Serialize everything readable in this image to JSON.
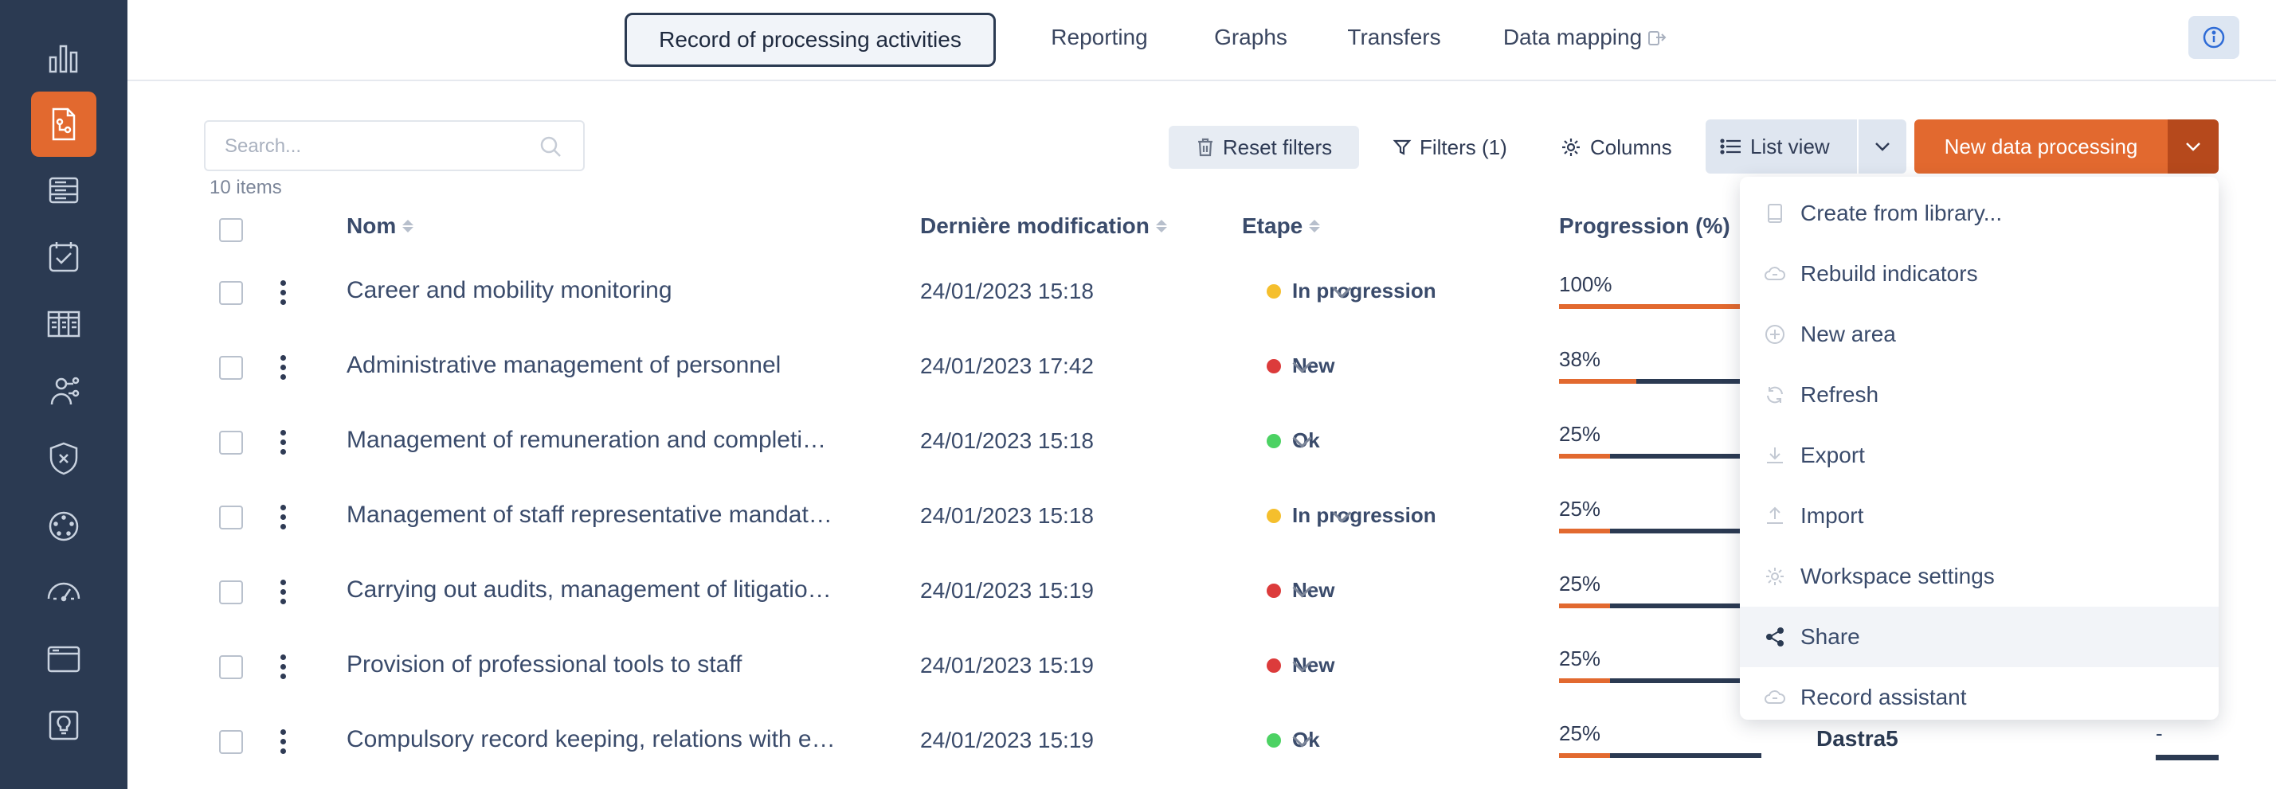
{
  "nav": {
    "tabs": [
      {
        "label": "Record of processing activities"
      },
      {
        "label": "Reporting"
      },
      {
        "label": "Graphs"
      },
      {
        "label": "Transfers"
      },
      {
        "label": "Data mapping"
      }
    ]
  },
  "sidebar": {
    "items": [
      {
        "icon": "bar-chart-icon"
      },
      {
        "icon": "document-flow-icon",
        "active": true
      },
      {
        "icon": "database-icon"
      },
      {
        "icon": "checklist-icon"
      },
      {
        "icon": "grid-list-icon"
      },
      {
        "icon": "person-network-icon"
      },
      {
        "icon": "shield-x-icon"
      },
      {
        "icon": "target-dial-icon"
      },
      {
        "icon": "gauge-icon"
      },
      {
        "icon": "folder-icon"
      },
      {
        "icon": "lightbulb-document-icon"
      }
    ]
  },
  "search": {
    "placeholder": "Search...",
    "value": ""
  },
  "items_count": "10 items",
  "toolbar": {
    "reset_filters": "Reset filters",
    "filters": "Filters (1)",
    "columns": "Columns",
    "list_view": "List view",
    "new_data_processing": "New data processing"
  },
  "table": {
    "headers": {
      "name": "Nom",
      "last_modified": "Dernière modification",
      "stage": "Etape",
      "progress": "Progression (%)"
    },
    "rows": [
      {
        "name": "Career and mobility monitoring",
        "date": "24/01/2023 15:18",
        "status": "In progression",
        "status_color": "#f5bf2d",
        "progress": "100%",
        "fill": 100
      },
      {
        "name": "Administrative management of personnel",
        "date": "24/01/2023 17:42",
        "status": "New",
        "status_color": "#dc3b3b",
        "progress": "38%",
        "fill": 38
      },
      {
        "name": "Management of remuneration and completi…",
        "date": "24/01/2023 15:18",
        "status": "Ok",
        "status_color": "#4cd263",
        "progress": "25%",
        "fill": 25
      },
      {
        "name": "Management of staff representative mandat…",
        "date": "24/01/2023 15:18",
        "status": "In progression",
        "status_color": "#f5bf2d",
        "progress": "25%",
        "fill": 25
      },
      {
        "name": "Carrying out audits, management of litigatio…",
        "date": "24/01/2023 15:19",
        "status": "New",
        "status_color": "#dc3b3b",
        "progress": "25%",
        "fill": 25
      },
      {
        "name": "Provision of professional tools to staff",
        "date": "24/01/2023 15:19",
        "status": "New",
        "status_color": "#dc3b3b",
        "progress": "25%",
        "fill": 25
      },
      {
        "name": "Compulsory record keeping, relations with e…",
        "date": "24/01/2023 15:19",
        "status": "Ok",
        "status_color": "#4cd263",
        "progress": "25%",
        "fill": 25,
        "owner": "Dastra5",
        "extra": "-"
      }
    ]
  },
  "dropdown": {
    "items": [
      {
        "label": "Create from library...",
        "icon": "book-icon"
      },
      {
        "label": "Rebuild indicators",
        "icon": "cloud-sync-icon"
      },
      {
        "label": "New area",
        "icon": "plus-circle-icon"
      },
      {
        "label": "Refresh",
        "icon": "refresh-icon"
      },
      {
        "label": "Export",
        "icon": "download-icon"
      },
      {
        "label": "Import",
        "icon": "upload-icon"
      },
      {
        "label": "Workspace settings",
        "icon": "gear-icon"
      },
      {
        "label": "Share",
        "icon": "share-icon",
        "hover": true
      },
      {
        "label": "Record assistant",
        "icon": "cloud-sync-icon"
      }
    ]
  },
  "colors": {
    "sidebar_bg": "#2b3a52",
    "accent": "#e2692f",
    "accent_dark": "#b6491c"
  }
}
